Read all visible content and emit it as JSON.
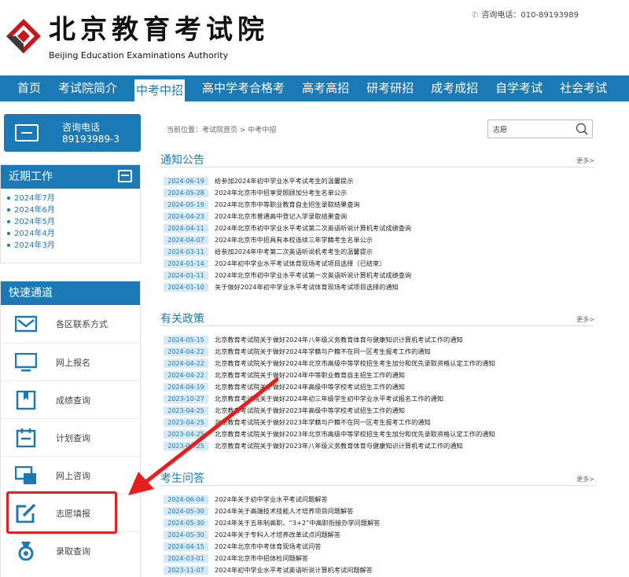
{
  "header": {
    "logo_cn": "北京教育考试院",
    "logo_en": "Beijing Education Examinations Authority",
    "hotline": "咨询电话：010-89193989"
  },
  "nav": {
    "items": [
      "首页",
      "考试院简介",
      "中考中招",
      "高中学考合格考",
      "高考高招",
      "研考研招",
      "成考成招",
      "自学考试",
      "社会考试"
    ],
    "active": "中考中招"
  },
  "sidebar": {
    "hotline_label": "咨询电话",
    "hotline_number": "89193989-3",
    "recent_title": "近期工作",
    "recent_items": [
      "2024年7月",
      "2024年6月",
      "2024年5月",
      "2024年4月",
      "2024年3月"
    ],
    "quick_title": "快速通道",
    "quick_items": [
      {
        "label": "各区联系方式",
        "icon": "mail-icon"
      },
      {
        "label": "网上报名",
        "icon": "monitor-icon"
      },
      {
        "label": "成绩查询",
        "icon": "bookmark-icon"
      },
      {
        "label": "计划查询",
        "icon": "calendar-icon"
      },
      {
        "label": "网上咨询",
        "icon": "chat-icon"
      },
      {
        "label": "志愿填报",
        "icon": "edit-icon"
      },
      {
        "label": "录取查询",
        "icon": "medal-icon"
      }
    ]
  },
  "breadcrumb": "当前位置：考试院首页 > 中考中招",
  "search": {
    "value": "志愿"
  },
  "sections": {
    "notices": {
      "title": "通知公告",
      "more": "更多>",
      "items": [
        {
          "date": "2024-06-19",
          "title": "给参加2024年初中学业水平考试考生的温馨提示"
        },
        {
          "date": "2024-05-28",
          "title": "2024年北京市中招享受照顾加分考生名单公示"
        },
        {
          "date": "2024-05-19",
          "title": "2024年北京市中等职业教育自主招生录取结果查询"
        },
        {
          "date": "2024-04-23",
          "title": "2024年北京市普通高中登记入学录取结果查询"
        },
        {
          "date": "2024-04-11",
          "title": "2024年北京市初中学业水平考试第二次英语听说计算机考试成绩查询"
        },
        {
          "date": "2024-04-07",
          "title": "2024年北京市中招具有本校连续三年学籍考生名单公示"
        },
        {
          "date": "2024-03-11",
          "title": "给参加2024年中考第二次英语听说机考考生的温馨提示"
        },
        {
          "date": "2024-01-14",
          "title": "2024年初中学业水平考试体育现场考试项目选择（已结束）"
        },
        {
          "date": "2024-01-11",
          "title": "2024年北京市初中学业水平考试第一次英语听说计算机考试成绩查询"
        },
        {
          "date": "2024-01-10",
          "title": "关于做好2024年初中学业水平考试体育现场考试项目选择的通知"
        }
      ]
    },
    "policies": {
      "title": "有关政策",
      "more": "更多>",
      "items": [
        {
          "date": "2024-05-15",
          "title": "北京教育考试院关于做好2024年八年级义务教育体育与健康知识计算机考试工作的通知"
        },
        {
          "date": "2024-04-22",
          "title": "北京教育考试院关于做好2024年学籍与户籍不在同一区考生报考工作的通知"
        },
        {
          "date": "2024-04-22",
          "title": "北京教育考试院关于做好2024年北京市高级中等学校招生考生加分和优先录取资格认定工作的通知"
        },
        {
          "date": "2024-04-22",
          "title": "北京教育考试院关于做好2024年中等职业教育自主招生工作的通知"
        },
        {
          "date": "2024-04-19",
          "title": "北京教育考试院关于做好2024年高级中等学校考试招生工作的通知"
        },
        {
          "date": "2023-10-27",
          "title": "北京教育考试院关于做好2024年初三年级学生初中学业水平考试报名工作的通知"
        },
        {
          "date": "2023-04-25",
          "title": "北京教育考试院关于做好2023年高级中等学校考试招生工作的通知"
        },
        {
          "date": "2023-04-25",
          "title": "北京教育考试院关于做好2023年学籍与户籍不在同一区考生报考工作的通知"
        },
        {
          "date": "2023-04-25",
          "title": "北京教育考试院关于做好2023年北京市高级中等学校招生考生加分和优先录取资格认定工作的通知"
        },
        {
          "date": "2023-04-25",
          "title": "北京教育考试院关于做好2023年八年级义务教育体育与健康知识计算机考试工作的通知"
        }
      ]
    },
    "qa": {
      "title": "考生问答",
      "more": "更多>",
      "items": [
        {
          "date": "2024-06-04",
          "title": "2024年关于初中学业水平考试问题解答"
        },
        {
          "date": "2024-05-30",
          "title": "2024年关于高端技术技能人才培养项目问题解答"
        },
        {
          "date": "2024-05-30",
          "title": "2024年关于五年制高职、“3+2”中高职衔接办学问题解答"
        },
        {
          "date": "2024-05-30",
          "title": "2024年关于专科人才培养改革试点问题解答"
        },
        {
          "date": "2024-04-15",
          "title": "2024年北京市中考体育现场考试问答"
        },
        {
          "date": "2024-03-01",
          "title": "2024年北京市中招体检问题解答"
        },
        {
          "date": "2023-11-07",
          "title": "2024年初中学业水平考试英语听说计算机考试问题解答"
        }
      ]
    }
  },
  "colors": {
    "brand": "#1b79b5",
    "annotation": "#e61e1e",
    "date_bg": "#d6e9f6"
  }
}
